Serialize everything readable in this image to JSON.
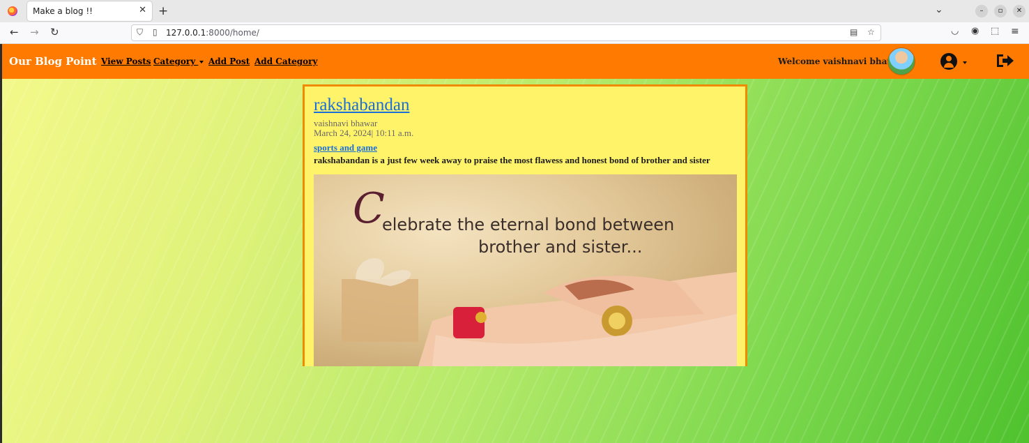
{
  "browser": {
    "tab_title": "Make a blog !!",
    "url_host": "127.0.0.1",
    "url_path": ":8000/home/"
  },
  "nav": {
    "brand": "Our Blog Point",
    "links": [
      "View Posts",
      "Category ",
      "Add Post",
      "Add Category"
    ],
    "welcome": "Welcome vaishnavi bhawar"
  },
  "post": {
    "title": "rakshabandan",
    "author": "vaishnavi bhawar",
    "date": "March 24, 2024| 10:11 a.m.",
    "category": "sports and game",
    "body": "rakshabandan is a just few week away to praise the most flawess and honest bond of brother and sister",
    "image_text_1": "elebrate the eternal bond between",
    "image_text_1_initial": "C",
    "image_text_2": "brother and sister..."
  },
  "colors": {
    "navbar": "#ff7a00",
    "post_bg": "#fff36a",
    "link": "#1a6ed8"
  }
}
